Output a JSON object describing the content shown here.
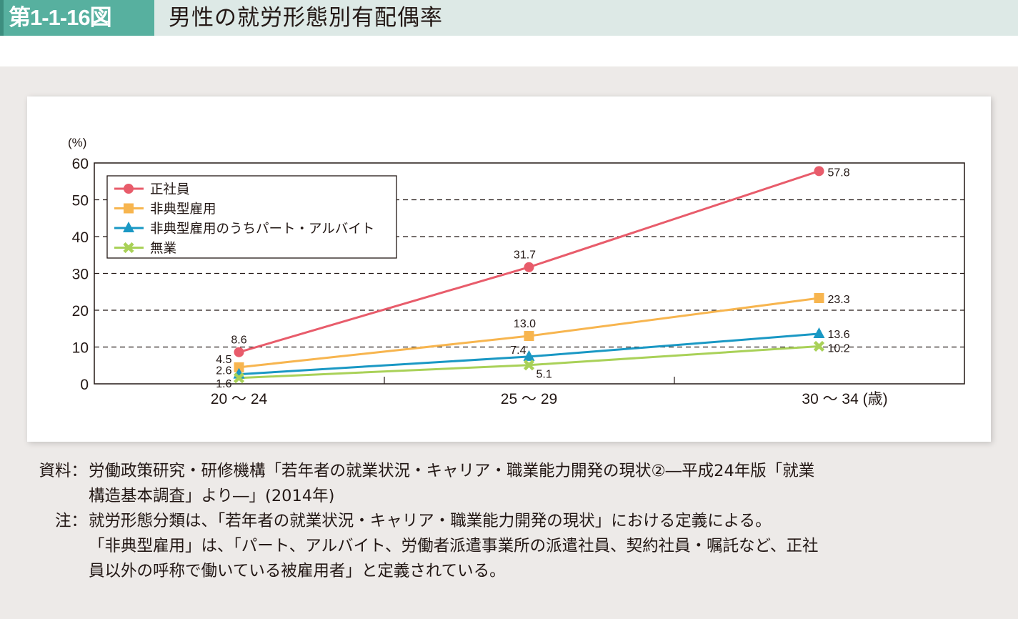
{
  "header": {
    "figure_number": "第1-1-16図",
    "title": "男性の就労形態別有配偶率"
  },
  "chart_data": {
    "type": "line",
    "title": "男性の就労形態別有配偶率",
    "ylabel": "(%)",
    "xlabel": "(歳)",
    "ylim": [
      0,
      60
    ],
    "yticks": [
      0,
      10,
      20,
      30,
      40,
      50,
      60
    ],
    "ytick_labels": [
      "0",
      "10",
      "20",
      "30",
      "40",
      "50",
      "60"
    ],
    "grid": "horizontal-dashed",
    "legend_position": "top-left",
    "categories": [
      "20～24",
      "25～29",
      "30～34"
    ],
    "category_labels": [
      "20 ～ 24",
      "25 ～ 29",
      "30 ～ 34 (歳)"
    ],
    "series": [
      {
        "name": "正社員",
        "marker": "circle",
        "color": "#e85c6b",
        "values": [
          8.6,
          31.7,
          57.8
        ],
        "labels": [
          "8.6",
          "31.7",
          "57.8"
        ]
      },
      {
        "name": "非典型雇用",
        "marker": "square",
        "color": "#f7b54f",
        "values": [
          4.5,
          13.0,
          23.3
        ],
        "labels": [
          "4.5",
          "13.0",
          "23.3"
        ]
      },
      {
        "name": "非典型雇用のうちパート・アルバイト",
        "marker": "triangle",
        "color": "#1a98c4",
        "values": [
          2.6,
          7.4,
          13.6
        ],
        "labels": [
          "2.6",
          "7.4",
          "13.6"
        ]
      },
      {
        "name": "無業",
        "marker": "x",
        "color": "#a9d158",
        "values": [
          1.6,
          5.1,
          10.2
        ],
        "labels": [
          "1.6",
          "5.1",
          "10.2"
        ]
      }
    ]
  },
  "notes": {
    "source_label": "資料：",
    "source_lines": [
      "労働政策研究・研修機構「若年者の就業状況・キャリア・職業能力開発の現状②―平成24年版「就業",
      "構造基本調査」より―」(2014年)"
    ],
    "note_label": "注：",
    "note_lines": [
      "就労形態分類は、「若年者の就業状況・キャリア・職業能力開発の現状」における定義による。",
      "「非典型雇用」は、「パート、アルバイト、労働者派遣事業所の派遣社員、契約社員・嘱託など、正社",
      "員以外の呼称で働いている被雇用者」と定義されている。"
    ]
  }
}
